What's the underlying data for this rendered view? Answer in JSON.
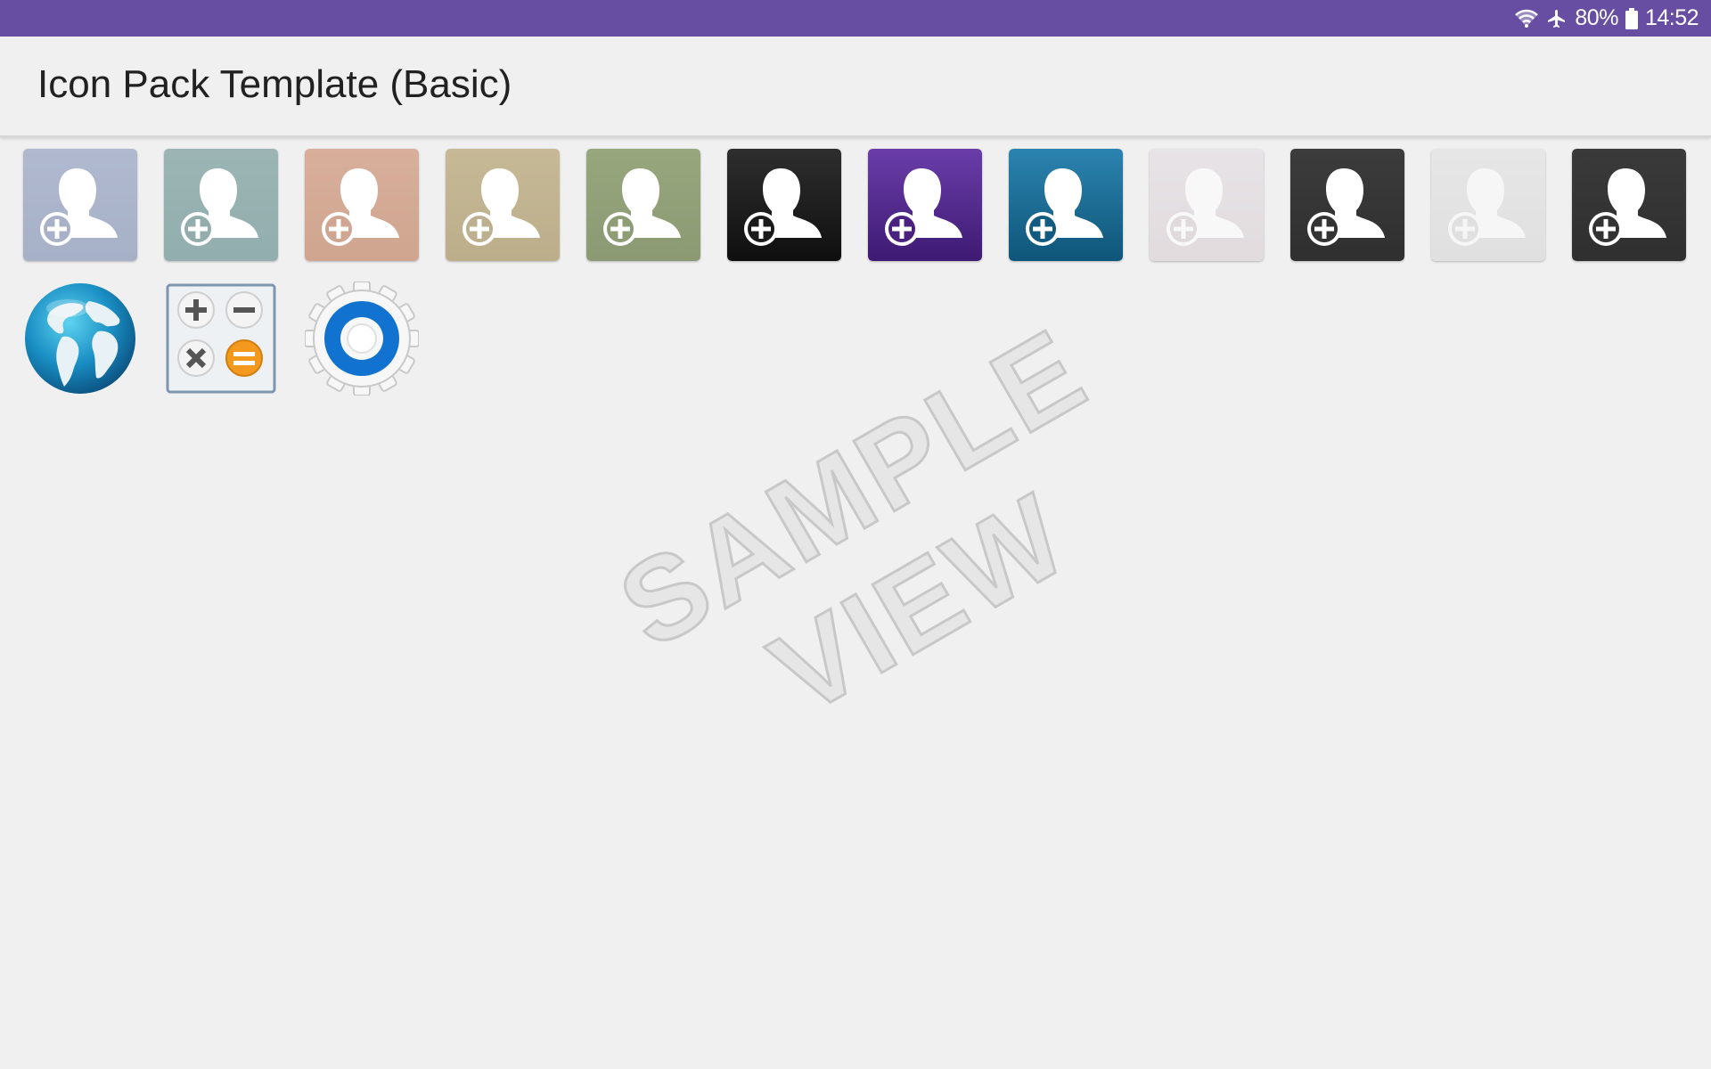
{
  "status_bar": {
    "battery": "80%",
    "time": "14:52",
    "color": "#684ea3",
    "icons": [
      "wifi-icon",
      "airplane-mode-icon",
      "battery-icon"
    ]
  },
  "app_bar": {
    "title": "Icon Pack Template (Basic)"
  },
  "add_contact_icons": [
    {
      "name": "add-contact-icon-slate",
      "bg_top": "#b0b9cf",
      "bg_bottom": "#a6b0c7",
      "fg": "#ffffff",
      "plus": "#a8b1c8",
      "opacity": 1
    },
    {
      "name": "add-contact-icon-teal-gray",
      "bg_top": "#9cb4b4",
      "bg_bottom": "#92aeae",
      "fg": "#ffffff",
      "plus": "#93adad",
      "opacity": 1
    },
    {
      "name": "add-contact-icon-salmon",
      "bg_top": "#d8af9b",
      "bg_bottom": "#cfa58f",
      "fg": "#ffffff",
      "plus": "#d0a692",
      "opacity": 1
    },
    {
      "name": "add-contact-icon-khaki",
      "bg_top": "#c6b996",
      "bg_bottom": "#bcae8b",
      "fg": "#ffffff",
      "plus": "#bdb08e",
      "opacity": 1
    },
    {
      "name": "add-contact-icon-olive",
      "bg_top": "#98a67e",
      "bg_bottom": "#8b9a72",
      "fg": "#ffffff",
      "plus": "#8e9d75",
      "opacity": 1
    },
    {
      "name": "add-contact-icon-black",
      "bg_top": "#2e2e2e",
      "bg_bottom": "#0f0f0f",
      "fg": "#ffffff",
      "plus": "#1a1a1a",
      "opacity": 1
    },
    {
      "name": "add-contact-icon-purple",
      "bg_top": "#6a3da9",
      "bg_bottom": "#3e1a73",
      "fg": "#ffffff",
      "plus": "#4a2180",
      "opacity": 1
    },
    {
      "name": "add-contact-icon-blue",
      "bg_top": "#2b84b0",
      "bg_bottom": "#0f5579",
      "fg": "#ffffff",
      "plus": "#115a80",
      "opacity": 1
    },
    {
      "name": "add-contact-icon-faded-mauve",
      "bg_top": "#e8e3e6",
      "bg_bottom": "#e1dbde",
      "fg": "#f8f8f8",
      "plus": "#e0dadd",
      "opacity": 1
    },
    {
      "name": "add-contact-icon-dark-gray",
      "bg_top": "#3c3c3c",
      "bg_bottom": "#2f2f2f",
      "fg": "#ffffff",
      "plus": "#333333",
      "opacity": 1
    },
    {
      "name": "add-contact-icon-faded-gray",
      "bg_top": "#e6e6e6",
      "bg_bottom": "#e0e0e0",
      "fg": "#f6f6f6",
      "plus": "#e0e0e0",
      "opacity": 1
    },
    {
      "name": "add-contact-icon-charcoal",
      "bg_top": "#3a3a3a",
      "bg_bottom": "#2f2f2f",
      "fg": "#ffffff",
      "plus": "#333333",
      "opacity": 1
    }
  ],
  "app_icons": [
    {
      "name": "browser-globe-icon"
    },
    {
      "name": "calculator-icon"
    },
    {
      "name": "settings-gear-icon"
    }
  ],
  "watermark": {
    "line1": "SAMPLE",
    "line2": "VIEW"
  }
}
